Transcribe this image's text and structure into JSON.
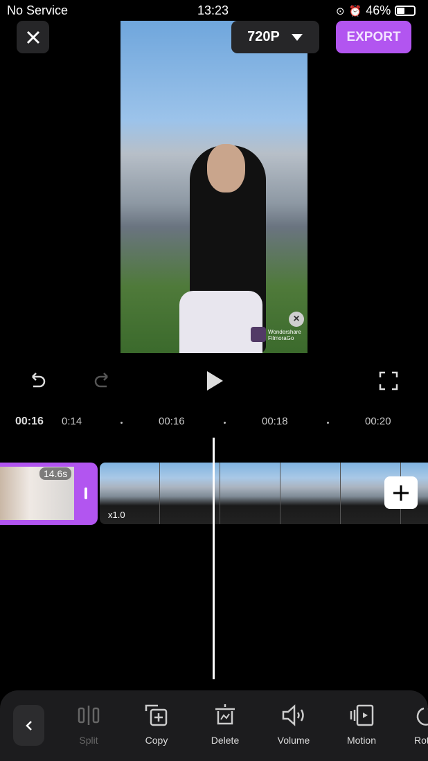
{
  "status_bar": {
    "carrier": "No Service",
    "time": "13:23",
    "battery": "46%"
  },
  "header": {
    "close_icon": "close-icon",
    "resolution": "720P",
    "export_label": "EXPORT",
    "accent": "#b255f0"
  },
  "preview": {
    "watermark_brand": "Wondershare",
    "watermark_product": "FilmoraGo"
  },
  "controls": {
    "current_time": "00:16"
  },
  "ruler": {
    "labels": [
      "0:14",
      "00:16",
      "00:18",
      "00:20"
    ]
  },
  "timeline": {
    "clip1_duration": "14.6s",
    "clip2_speed": "x1.0"
  },
  "toolbar": {
    "items": [
      {
        "label": "Split",
        "icon": "split-icon"
      },
      {
        "label": "Copy",
        "icon": "copy-icon"
      },
      {
        "label": "Delete",
        "icon": "delete-icon"
      },
      {
        "label": "Volume",
        "icon": "volume-icon"
      },
      {
        "label": "Motion",
        "icon": "motion-icon"
      },
      {
        "label": "Rot",
        "icon": "rotate-icon"
      }
    ]
  }
}
